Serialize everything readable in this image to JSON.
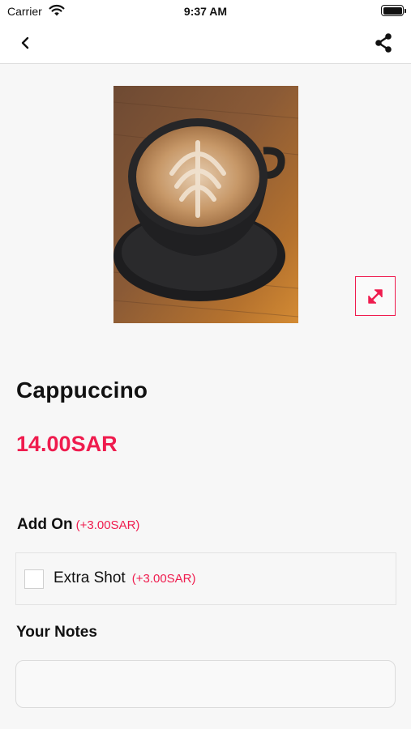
{
  "status_bar": {
    "carrier": "Carrier",
    "time": "9:37 AM"
  },
  "nav": {
    "back_icon": "chevron-left-icon",
    "share_icon": "share-icon"
  },
  "product": {
    "name": "Cappuccino",
    "price": "14.00SAR",
    "image_icon": "cappuccino-photo",
    "expand_icon": "expand-diagonal-icon"
  },
  "addons": {
    "heading": "Add On",
    "heading_price": "(+3.00SAR)",
    "items": [
      {
        "name": "Extra Shot",
        "price": "(+3.00SAR)",
        "checked": false
      }
    ]
  },
  "notes": {
    "label": "Your Notes",
    "value": "",
    "placeholder": ""
  },
  "colors": {
    "accent": "#ef1c4e",
    "background": "#f7f7f7",
    "header": "#ffffff"
  }
}
